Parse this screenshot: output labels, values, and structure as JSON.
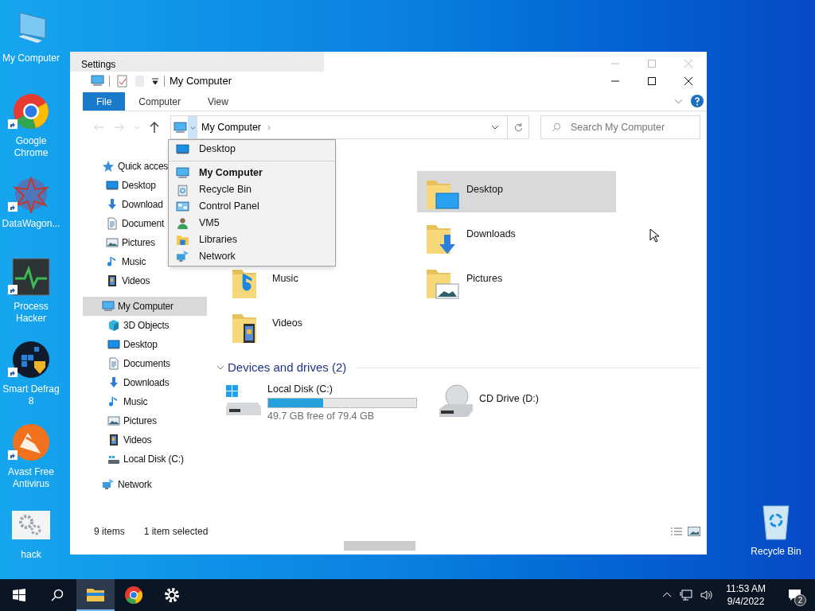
{
  "desktop_icons": [
    {
      "label": "My Computer",
      "shortcut": false
    },
    {
      "label": "Google Chrome",
      "shortcut": true
    },
    {
      "label": "DataWagon...",
      "shortcut": true
    },
    {
      "label": "Process Hacker",
      "shortcut": true
    },
    {
      "label": "Smart Defrag 8",
      "shortcut": true
    },
    {
      "label": "Avast Free Antivirus",
      "shortcut": true
    },
    {
      "label": "hack",
      "shortcut": false
    }
  ],
  "recycle_bin": {
    "label": "Recycle Bin"
  },
  "background_window": {
    "title": "Settings"
  },
  "window": {
    "title": "My Computer"
  },
  "ribbon_tabs": [
    {
      "label": "File",
      "selected": true
    },
    {
      "label": "Computer",
      "selected": false
    },
    {
      "label": "View",
      "selected": false
    }
  ],
  "address_bar": {
    "location": "My Computer"
  },
  "search": {
    "placeholder": "Search My Computer"
  },
  "navigation": [
    {
      "label": "Quick acces",
      "selected": false,
      "children": [
        {
          "label": "Desktop",
          "selected": false
        },
        {
          "label": "Download",
          "selected": false
        },
        {
          "label": "Document",
          "selected": false
        },
        {
          "label": "Pictures",
          "selected": false
        },
        {
          "label": "Music",
          "selected": false
        },
        {
          "label": "Videos",
          "selected": false
        }
      ]
    },
    {
      "label": "My Computer",
      "selected": true,
      "children": [
        {
          "label": "3D Objects",
          "selected": false
        },
        {
          "label": "Desktop",
          "selected": false
        },
        {
          "label": "Documents",
          "selected": false
        },
        {
          "label": "Downloads",
          "selected": false
        },
        {
          "label": "Music",
          "selected": false
        },
        {
          "label": "Pictures",
          "selected": false
        },
        {
          "label": "Videos",
          "selected": false
        },
        {
          "label": "Local Disk (C:)",
          "selected": false
        }
      ]
    },
    {
      "label": "Network",
      "selected": false
    }
  ],
  "folders": {
    "left": [
      {
        "label": "Music",
        "selected": false
      },
      {
        "label": "Videos",
        "selected": false
      }
    ],
    "right": [
      {
        "label": "Desktop",
        "selected": true
      },
      {
        "label": "Downloads",
        "selected": false
      },
      {
        "label": "Pictures",
        "selected": false
      }
    ]
  },
  "devices": {
    "title": "Devices and drives (2)",
    "expanded": true,
    "drives": [
      {
        "kind": "disk",
        "label": "Local Disk (C:)",
        "level": 0.37,
        "detail": "49.7 GB free of 79.4 GB"
      },
      {
        "kind": "optical",
        "label": "CD Drive (D:)"
      }
    ]
  },
  "address_menu": {
    "groups": [
      [
        {
          "label": "Desktop",
          "current": false
        }
      ],
      [
        {
          "label": "My Computer",
          "current": true
        },
        {
          "label": "Recycle Bin",
          "current": false
        },
        {
          "label": "Control Panel",
          "current": false
        },
        {
          "label": "VM5",
          "current": false
        },
        {
          "label": "Libraries",
          "current": false
        },
        {
          "label": "Network",
          "current": false
        }
      ]
    ]
  },
  "status_bar": {
    "items": "9 items",
    "selection": "1 item selected"
  },
  "taskbar": {
    "apps": [
      {
        "active": true
      },
      {
        "active": false
      },
      {
        "active": false
      }
    ],
    "time": "11:53 AM",
    "date": "9/4/2022",
    "notifications": "2"
  }
}
